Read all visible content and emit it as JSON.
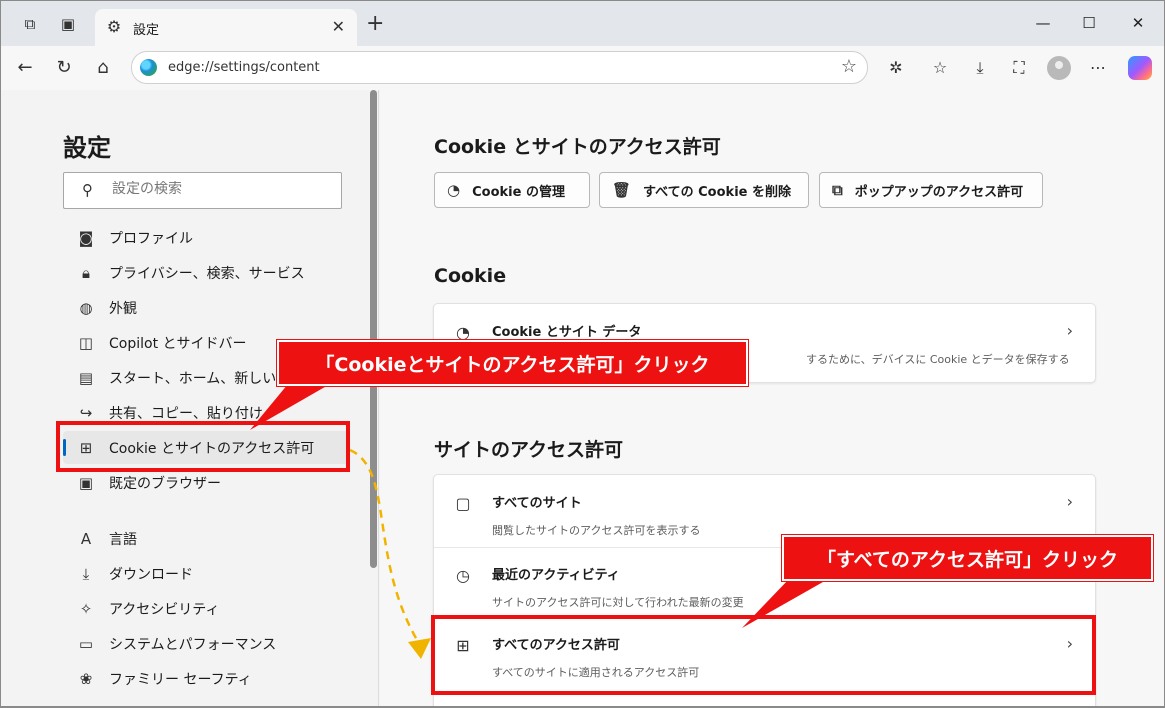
{
  "browser": {
    "tab_title": "設定",
    "new_tab": "+",
    "close_tab": "✕",
    "url": "edge://settings/content",
    "window": {
      "minimize": "—",
      "maximize": "☐",
      "close": "✕"
    }
  },
  "sidebar": {
    "title": "設定",
    "search_placeholder": "設定の検索",
    "items": [
      {
        "label": "プロファイル",
        "icon": "profile-icon"
      },
      {
        "label": "プライバシー、検索、サービス",
        "icon": "lock-icon"
      },
      {
        "label": "外観",
        "icon": "palette-icon"
      },
      {
        "label": "Copilot とサイドバー",
        "icon": "sidebar-icon"
      },
      {
        "label": "スタート、ホーム、新しいタブ",
        "icon": "home-tab-icon"
      },
      {
        "label": "共有、コピー、貼り付け",
        "icon": "share-icon"
      },
      {
        "label": "Cookie とサイトのアクセス許可",
        "icon": "site-permissions-icon"
      },
      {
        "label": "既定のブラウザー",
        "icon": "default-browser-icon"
      },
      {
        "label": "言語",
        "icon": "language-icon"
      },
      {
        "label": "ダウンロード",
        "icon": "download-icon"
      },
      {
        "label": "アクセシビリティ",
        "icon": "accessibility-icon"
      },
      {
        "label": "システムとパフォーマンス",
        "icon": "laptop-icon"
      },
      {
        "label": "ファミリー セーフティ",
        "icon": "family-icon"
      }
    ]
  },
  "main": {
    "heading": "Cookie とサイトのアクセス許可",
    "buttons": [
      {
        "label": "Cookie の管理",
        "icon": "cookie-icon"
      },
      {
        "label": "すべての Cookie を削除",
        "icon": "trash-icon"
      },
      {
        "label": "ポップアップのアクセス許可",
        "icon": "popup-icon"
      }
    ],
    "cookie_section": {
      "heading": "Cookie",
      "row": {
        "title": "Cookie とサイト データ",
        "desc": "するために、デバイスに Cookie とデータを保存する"
      }
    },
    "site_section": {
      "heading": "サイトのアクセス許可",
      "rows": [
        {
          "title": "すべてのサイト",
          "desc": "閲覧したサイトのアクセス許可を表示する"
        },
        {
          "title": "最近のアクティビティ",
          "desc": "サイトのアクセス許可に対して行われた最新の変更"
        },
        {
          "title": "すべてのアクセス許可",
          "desc": "すべてのサイトに適用されるアクセス許可"
        }
      ]
    }
  },
  "annotations": {
    "callout1": "「Cookieとサイトのアクセス許可」クリック",
    "callout2": "「すべてのアクセス許可」クリック",
    "color": "#ee1111",
    "arrow_color": "#f0b400"
  }
}
